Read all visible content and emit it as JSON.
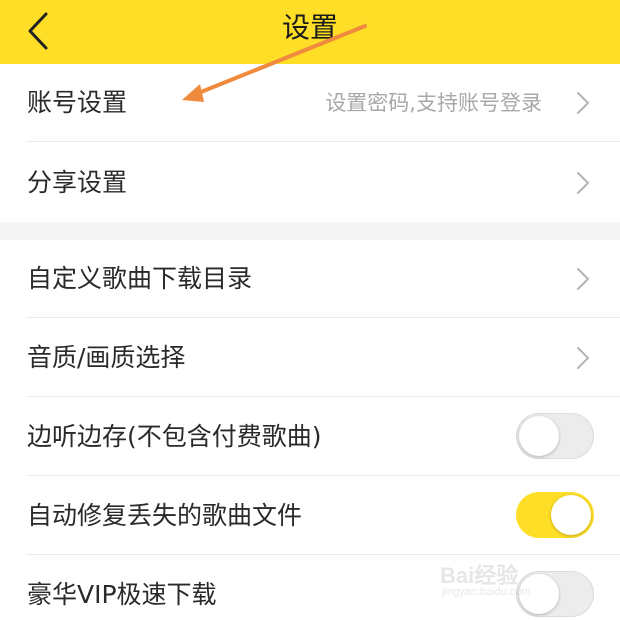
{
  "header": {
    "title": "设置",
    "back_icon": "chevron-left-icon"
  },
  "sections": [
    {
      "items": [
        {
          "label": "账号设置",
          "hint": "设置密码,支持账号登录",
          "control": "chevron"
        },
        {
          "label": "分享设置",
          "control": "chevron"
        }
      ]
    },
    {
      "items": [
        {
          "label": "自定义歌曲下载目录",
          "control": "chevron"
        },
        {
          "label": "音质/画质选择",
          "control": "chevron"
        },
        {
          "label": "边听边存(不包含付费歌曲)",
          "control": "toggle",
          "toggle_state": "off"
        },
        {
          "label": "自动修复丢失的歌曲文件",
          "control": "toggle",
          "toggle_state": "on"
        },
        {
          "label": "豪华VIP极速下载",
          "control": "toggle",
          "toggle_state": "off"
        }
      ]
    }
  ],
  "annotation": {
    "type": "arrow",
    "color": "#f08a3c",
    "points_to": "账号设置"
  },
  "watermark": {
    "text": "Bai经验",
    "subtext": "jingyan.baidu.com"
  },
  "colors": {
    "accent": "#fede27",
    "background": "#f5f5f5",
    "card": "#ffffff",
    "hint_text": "#a8a8a8"
  }
}
